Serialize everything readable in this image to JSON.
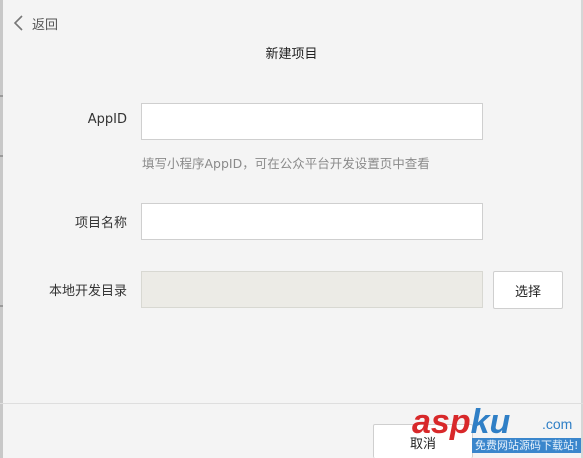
{
  "nav": {
    "back_label": "返回"
  },
  "dialog": {
    "title": "新建项目"
  },
  "form": {
    "appid": {
      "label": "AppID",
      "value": "",
      "hint": "填写小程序AppID，可在公众平台开发设置页中查看"
    },
    "project_name": {
      "label": "项目名称",
      "value": ""
    },
    "local_dir": {
      "label": "本地开发目录",
      "value": "",
      "choose_label": "选择"
    }
  },
  "footer": {
    "cancel_label": "取消"
  },
  "watermark": {
    "brand_red": "asp",
    "brand_blue": "ku",
    "suffix": ".com",
    "sub": "免费网站源码下载站!"
  },
  "colors": {
    "background": "#f4f4f4",
    "input_border": "#cfcfcf",
    "disabled_input": "#ecebe6",
    "hint": "#8a8a8a"
  }
}
